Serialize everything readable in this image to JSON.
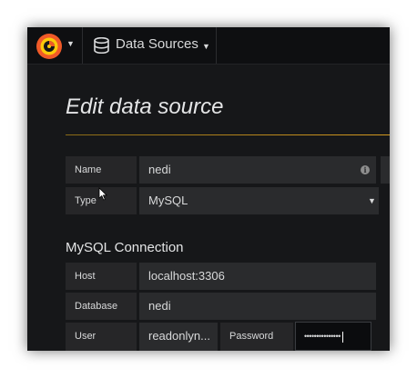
{
  "navbar": {
    "logo_icon": "grafana-logo-icon",
    "logo_colors": {
      "outer": "#f05a28",
      "inner": "#fbca0a"
    },
    "menu_label": "Data Sources",
    "menu_icon": "database-icon"
  },
  "page": {
    "title": "Edit data source",
    "accent_color": "#eb7b18"
  },
  "fields": {
    "name": {
      "label": "Name",
      "value": "nedi",
      "icon": "info-icon"
    },
    "type": {
      "label": "Type",
      "value": "MySQL",
      "icon": "caret-down-icon"
    }
  },
  "connection": {
    "section_title": "MySQL Connection",
    "host": {
      "label": "Host",
      "value": "localhost:3306"
    },
    "database": {
      "label": "Database",
      "value": "nedi"
    },
    "user": {
      "label": "User",
      "value": "readonlyn..."
    },
    "password": {
      "label": "Password",
      "value": "•••••••••••••••"
    }
  }
}
